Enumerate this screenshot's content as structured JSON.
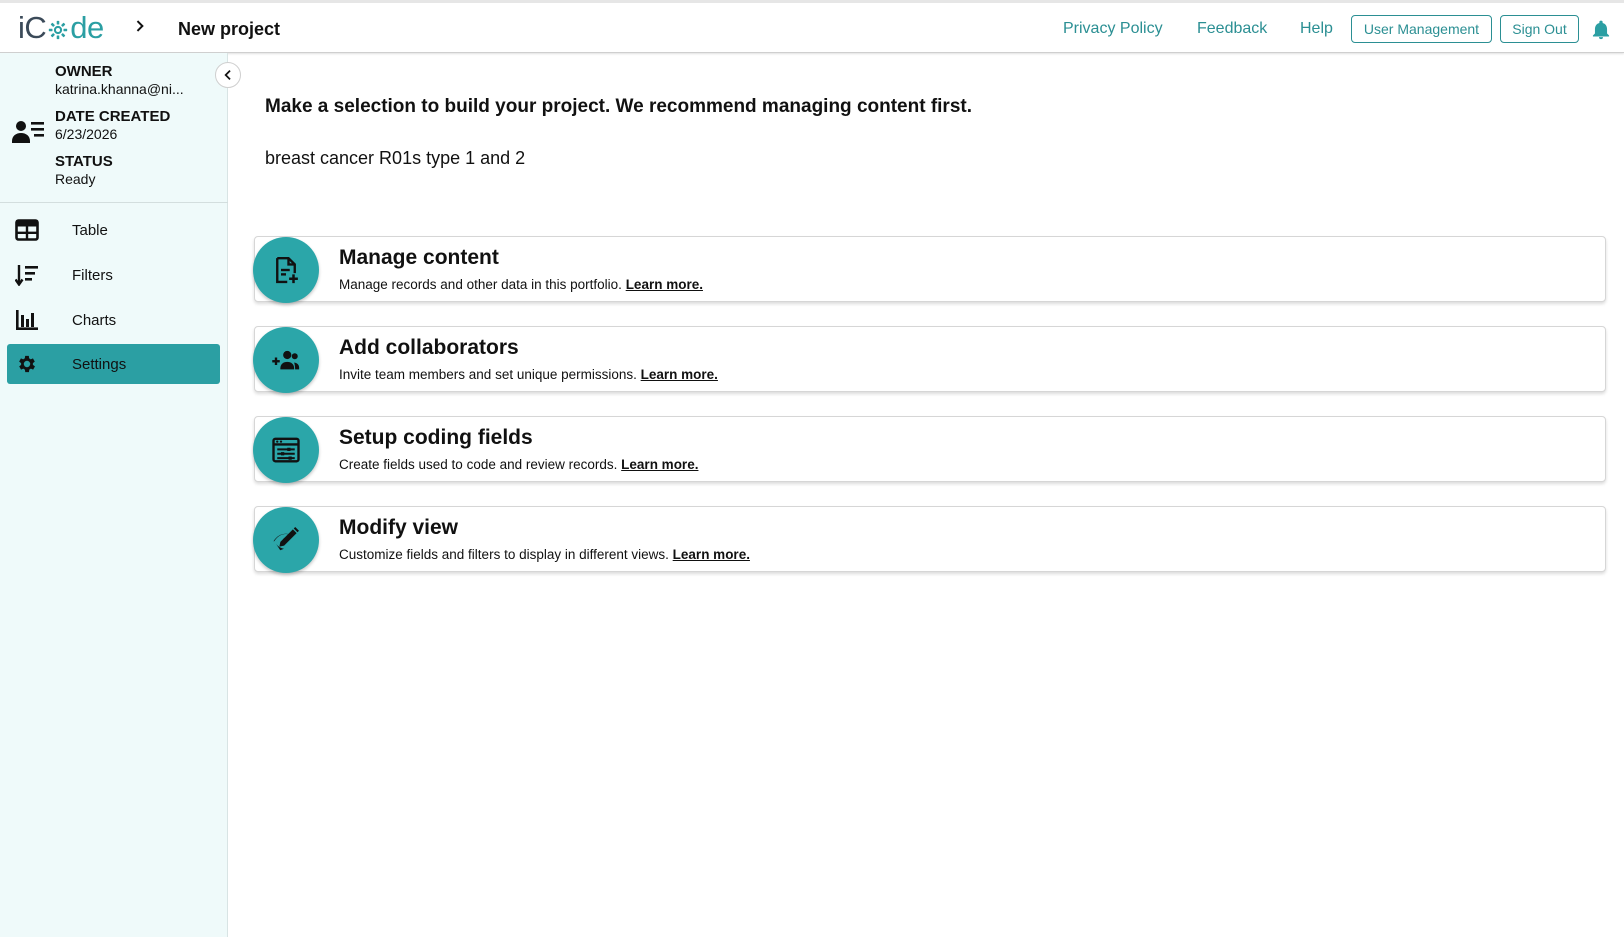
{
  "header": {
    "logo": {
      "prefix": "iC",
      "suffix": "de"
    },
    "page_title": "New project",
    "links": {
      "privacy": "Privacy Policy",
      "feedback": "Feedback",
      "help": "Help"
    },
    "buttons": {
      "user_management": "User Management",
      "sign_out": "Sign Out"
    },
    "accent_color": "#2b8f93"
  },
  "sidebar": {
    "owner_label": "OWNER",
    "owner_value": "katrina.khanna@ni...",
    "date_label": "DATE CREATED",
    "date_value": "6/23/2026",
    "status_label": "STATUS",
    "status_value": "Ready",
    "items": [
      {
        "label": "Table",
        "icon": "table-icon"
      },
      {
        "label": "Filters",
        "icon": "filters-icon"
      },
      {
        "label": "Charts",
        "icon": "charts-icon"
      },
      {
        "label": "Settings",
        "icon": "gear-icon",
        "active": true
      }
    ],
    "background": "#effafa",
    "active_color": "#2b9fa3"
  },
  "main": {
    "intro": "Make a selection to build your project. We recommend managing content first.",
    "project_name": "breast cancer R01s type 1 and 2",
    "cards": [
      {
        "title": "Manage content",
        "description": "Manage records and other data in this portfolio.",
        "link": "Learn more.",
        "icon": "add-document-icon"
      },
      {
        "title": "Add collaborators",
        "description": "Invite team members and set unique permissions.",
        "link": "Learn more.",
        "icon": "add-group-icon"
      },
      {
        "title": "Setup coding fields",
        "description": "Create fields used to code and review records.",
        "link": "Learn more.",
        "icon": "coding-fields-icon"
      },
      {
        "title": "Modify view",
        "description": "Customize fields and filters to display in different views.",
        "link": "Learn more.",
        "icon": "edit-view-icon"
      }
    ],
    "card_icon_color": "#2ba6a9"
  }
}
